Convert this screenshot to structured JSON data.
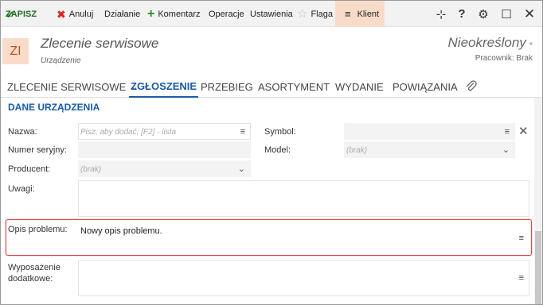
{
  "toolbar": {
    "save_label": "ZAPISZ",
    "cancel_label": "Anuluj",
    "actions_label": "Działanie",
    "comment_label": "Komentarz",
    "operations_label": "Operacje",
    "settings_label": "Ustawienia",
    "flag_label": "Flaga",
    "client_label": "Klient",
    "icons": {
      "save": "✔",
      "cancel": "✖",
      "comment": "+",
      "flag": "☆",
      "client": "≡",
      "pin": "⊹",
      "help": "?",
      "gear": "⚙",
      "max": "☐",
      "close": "✕"
    }
  },
  "header": {
    "badge": "ZI",
    "title": "Zlecenie serwisowe",
    "subtitle": "Urządzenie",
    "status": "Nieokreślony",
    "status_dot": "•",
    "worker": "Pracownik: Brak"
  },
  "tabs": [
    {
      "label": "ZLECENIE SERWISOWE"
    },
    {
      "label": "ZGŁOSZENIE"
    },
    {
      "label": "PRZEBIEG"
    },
    {
      "label": "ASORTYMENT"
    },
    {
      "label": "WYDANIE"
    },
    {
      "label": "POWIĄZANIA"
    }
  ],
  "tab_chevron": "⌄",
  "attachment_icon": "📎",
  "section": {
    "title": "DANE URZĄDZENIA"
  },
  "form": {
    "name_label": "Nazwa:",
    "name_placeholder": "Pisz, aby dodać; [F2] - lista",
    "symbol_label": "Symbol:",
    "serial_label": "Numer seryjny:",
    "model_label": "Model:",
    "model_placeholder": "(brak)",
    "producer_label": "Producent:",
    "producer_placeholder": "(brak)",
    "notes_label": "Uwagi:",
    "problem_label": "Opis problemu:",
    "problem_value": "Nowy opis problemu.",
    "equipment_label_1": "Wyposażenie",
    "equipment_label_2": "dodatkowe:",
    "menu_icon": "≡",
    "chevron_icon": "⌄",
    "clear_icon": "✕"
  },
  "colors": {
    "accent": "#1a5aa8",
    "badge_bg": "#f8dcc9",
    "badge_fg": "#c1501d",
    "highlight": "#e0454a",
    "save": "#2e8b2e",
    "cancel": "#dd2222"
  }
}
